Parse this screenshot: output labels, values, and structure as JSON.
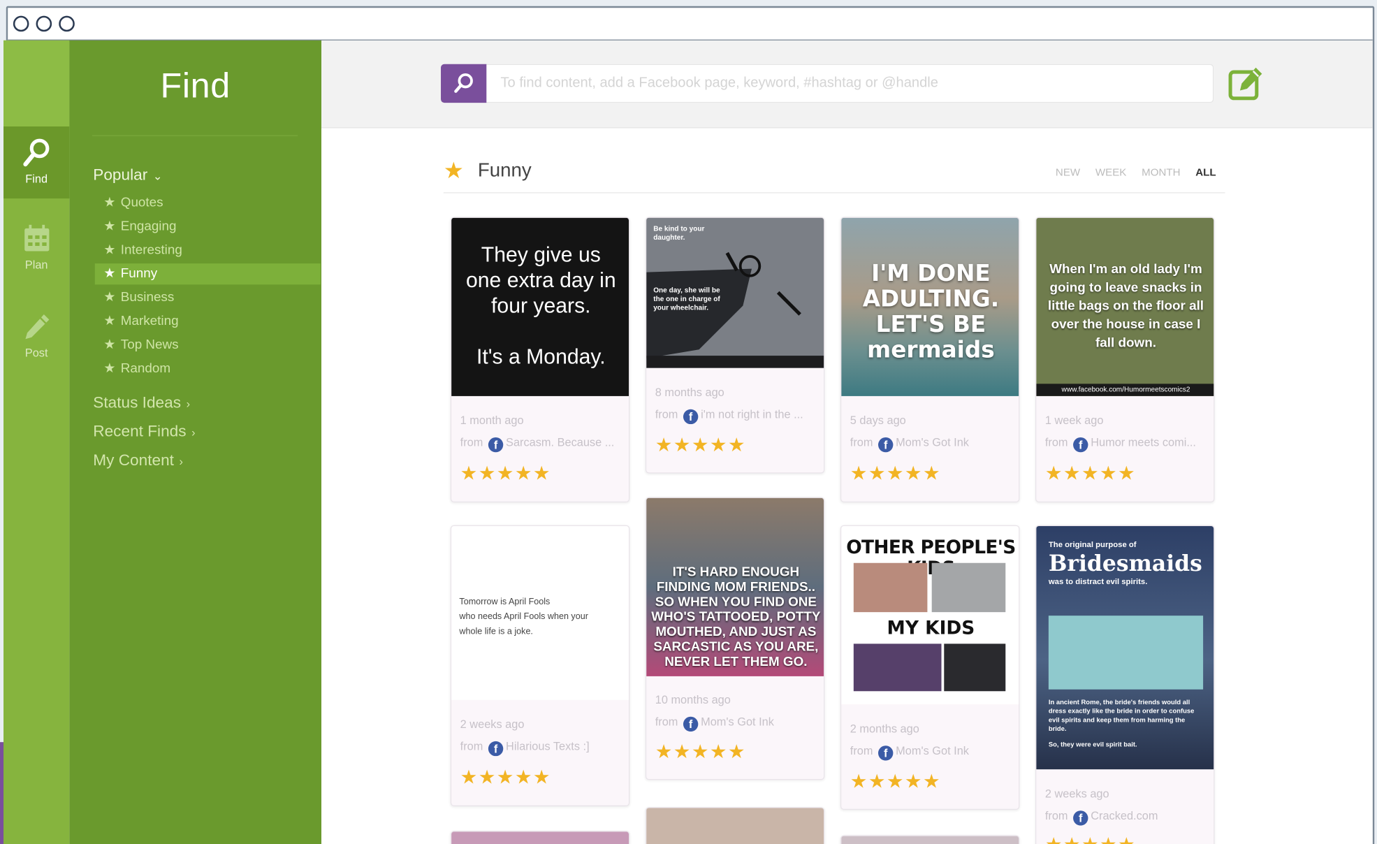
{
  "nav_rail": [
    {
      "label": "Find",
      "active": true,
      "icon": "search-icon"
    },
    {
      "label": "Plan",
      "active": false,
      "icon": "calendar-icon"
    },
    {
      "label": "Post",
      "active": false,
      "icon": "pencil-icon"
    }
  ],
  "sidebar": {
    "title": "Find",
    "popular_label": "Popular",
    "popular_items": [
      {
        "label": "Quotes",
        "active": false
      },
      {
        "label": "Engaging",
        "active": false
      },
      {
        "label": "Interesting",
        "active": false
      },
      {
        "label": "Funny",
        "active": true
      },
      {
        "label": "Business",
        "active": false
      },
      {
        "label": "Marketing",
        "active": false
      },
      {
        "label": "Top News",
        "active": false
      },
      {
        "label": "Random",
        "active": false
      }
    ],
    "links": [
      {
        "label": "Status Ideas"
      },
      {
        "label": "Recent Finds"
      },
      {
        "label": "My Content"
      }
    ]
  },
  "search": {
    "placeholder": "To find content, add a Facebook page, keyword, #hashtag or @handle"
  },
  "feed": {
    "title": "Funny",
    "filters": [
      "NEW",
      "WEEK",
      "MONTH",
      "ALL"
    ],
    "active_filter": "ALL",
    "cards": [
      {
        "img_text": "They give us one extra day in four years.\n\nIt's a Monday.",
        "age": "1 month ago",
        "from_label": "from",
        "source": "Sarcasm. Because ...",
        "rating": 5
      },
      {
        "img_text_top": "Be kind to your daughter.",
        "img_text_mid": "One day, she will be the one in charge of your wheelchair.",
        "age": "8 months ago",
        "from_label": "from",
        "source": "i'm not right in the ...",
        "rating": 5
      },
      {
        "img_text": "I'M DONE ADULTING. LET'S BE mermaids",
        "age": "5 days ago",
        "from_label": "from",
        "source": "Mom's Got Ink",
        "rating": 5
      },
      {
        "img_text": "When I'm an old lady I'm going to leave snacks in little bags on the floor all over the house in case I fall down.",
        "img_caption": "www.facebook.com/Humormeetscomics2",
        "age": "1 week ago",
        "from_label": "from",
        "source": "Humor meets comi...",
        "rating": 5
      },
      {
        "img_text": "Tomorrow is April Fools\nwho needs April Fools when your whole life is a joke.",
        "age": "2 weeks ago",
        "from_label": "from",
        "source": "Hilarious Texts :]",
        "rating": 5
      },
      {
        "img_text": "IT'S HARD ENOUGH FINDING MOM FRIENDS.. SO WHEN YOU FIND ONE WHO'S TATTOOED, POTTY MOUTHED, AND JUST AS SARCASTIC AS YOU ARE, NEVER LET THEM GO.",
        "age": "10 months ago",
        "from_label": "from",
        "source": "Mom's Got Ink",
        "rating": 5
      },
      {
        "img_text_top": "OTHER PEOPLE'S KIDS",
        "img_text_mid": "MY KIDS",
        "age": "2 months ago",
        "from_label": "from",
        "source": "Mom's Got Ink",
        "rating": 5
      },
      {
        "img_text_top": "The original purpose of",
        "img_text_big": "Bridesmaids",
        "img_text_sub": "was to distract evil spirits.",
        "img_text_body": "In ancient Rome, the bride's friends would all dress exactly like the bride in order to confuse evil spirits and keep them from harming the bride.",
        "img_text_end": "So, they were evil spirit bait.",
        "age": "2 weeks ago",
        "from_label": "from",
        "source": "Cracked.com",
        "rating": 5
      }
    ]
  },
  "colors": {
    "rail_green": "#86b43e",
    "sidebar_green": "#6a9a2d",
    "active_green": "#7db03a",
    "accent_purple": "#7a4f9c",
    "star_gold": "#f2b424",
    "facebook_blue": "#3b5ba6"
  }
}
